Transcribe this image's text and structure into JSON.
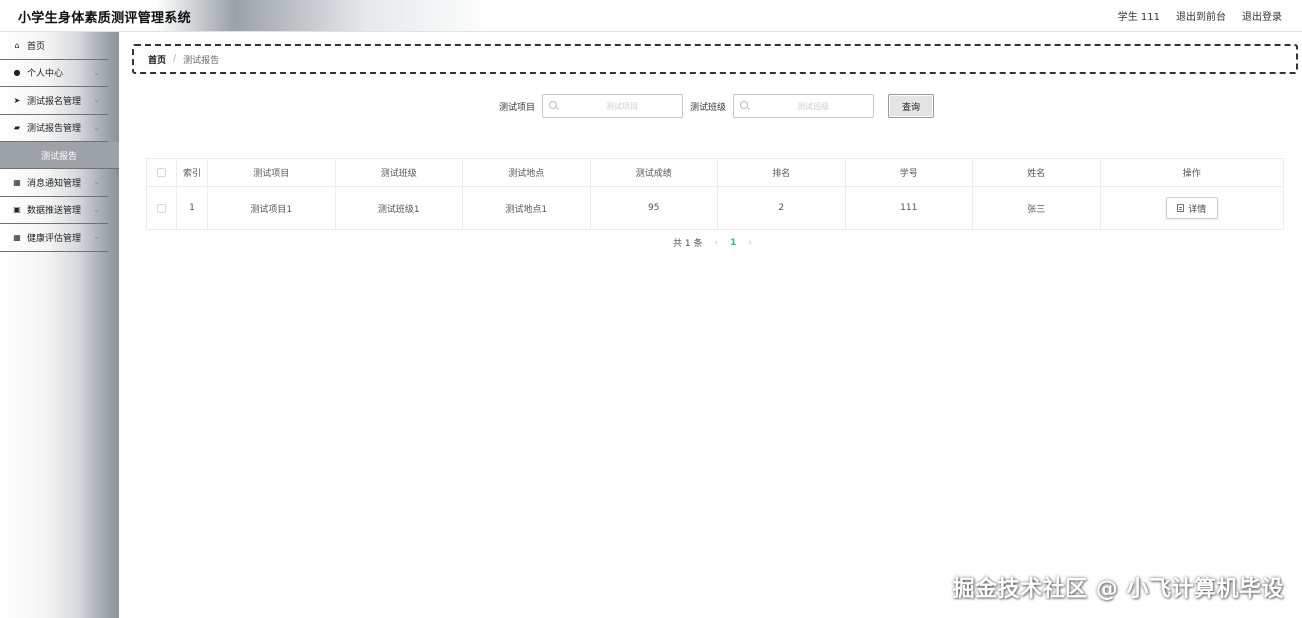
{
  "header": {
    "app_title": "小学生身体素质测评管理系统",
    "user_label": "学生 111",
    "to_frontend_label": "退出到前台",
    "logout_label": "退出登录"
  },
  "sidebar": {
    "items": [
      {
        "label": "首页",
        "icon": "home-icon",
        "expandable": false
      },
      {
        "label": "个人中心",
        "icon": "user-icon",
        "expandable": true
      },
      {
        "label": "测试报名管理",
        "icon": "send-icon",
        "expandable": true
      },
      {
        "label": "测试报告管理",
        "icon": "car-icon",
        "expandable": true
      },
      {
        "label": "测试报告",
        "icon": "",
        "sub": true,
        "active": true
      },
      {
        "label": "消息通知管理",
        "icon": "grid-icon",
        "expandable": true
      },
      {
        "label": "数据推送管理",
        "icon": "briefcase-icon",
        "expandable": true
      },
      {
        "label": "健康评估管理",
        "icon": "grid-icon",
        "expandable": true
      }
    ]
  },
  "breadcrumb": {
    "home": "首页",
    "separator": "/",
    "current": "测试报告"
  },
  "search": {
    "field1_label": "测试项目",
    "field1_placeholder": "测试项目",
    "field1_value": "",
    "field2_label": "测试班级",
    "field2_placeholder": "测试班级",
    "field2_value": "",
    "button_label": "查询"
  },
  "table": {
    "headers": [
      "索引",
      "测试项目",
      "测试班级",
      "测试地点",
      "测试成绩",
      "排名",
      "学号",
      "姓名",
      "操作"
    ],
    "rows": [
      {
        "index": "1",
        "test_item": "测试项目1",
        "test_class": "测试班级1",
        "test_location": "测试地点1",
        "score": "95",
        "rank": "2",
        "student_id": "111",
        "name": "张三",
        "action_label": "详情"
      }
    ]
  },
  "pagination": {
    "total_text": "共 1 条",
    "prev": "‹",
    "current_page": "1",
    "next": "›"
  },
  "watermark": "掘金技术社区 @ 小飞计算机毕设",
  "colors": {
    "accent_page": "#2db7a3",
    "active_sub_bg": "#9ea3a8"
  }
}
